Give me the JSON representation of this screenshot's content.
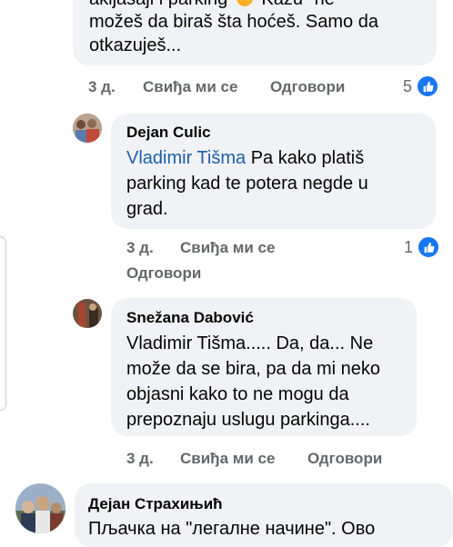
{
  "comment0": {
    "lines": [
      "akijasaji i parking",
      "možeš da biraš šta hoćeš. Samo da",
      "otkazuješ..."
    ],
    "line0_tail": "Kažu \"ne",
    "time": "3 д.",
    "like": "Свиђа ми се",
    "reply": "Одговори",
    "reactions": "5"
  },
  "comment1": {
    "author": "Dejan Culic",
    "mention": "Vladimir Tišma",
    "lines": [
      "Pa kako platiš",
      "parking kad te potera negde u",
      "grad."
    ],
    "time": "3 д.",
    "like": "Свиђа ми се",
    "reply": "Одговори",
    "reactions": "1"
  },
  "comment2": {
    "author": "Snežana Dabović",
    "lines": [
      "Vladimir Tišma..... Da, da... Ne",
      "može da se bira, pa da mi neko",
      "objasni kako to ne mogu da",
      "prepoznaju uslugu parkinga...."
    ],
    "time": "3 д.",
    "like": "Свиђа ми се",
    "reply": "Одговори"
  },
  "comment3": {
    "author": "Дејан Страхињић",
    "line0": "Пљачка на \"легалне начине\". Ово"
  },
  "colors": {
    "bubble": "#f0f2f5",
    "mention": "#1d5fa8",
    "meta": "#65676b",
    "like_blue": "#1877f2"
  },
  "icons": [
    "frown-emoji-icon",
    "like-thumb-icon"
  ]
}
